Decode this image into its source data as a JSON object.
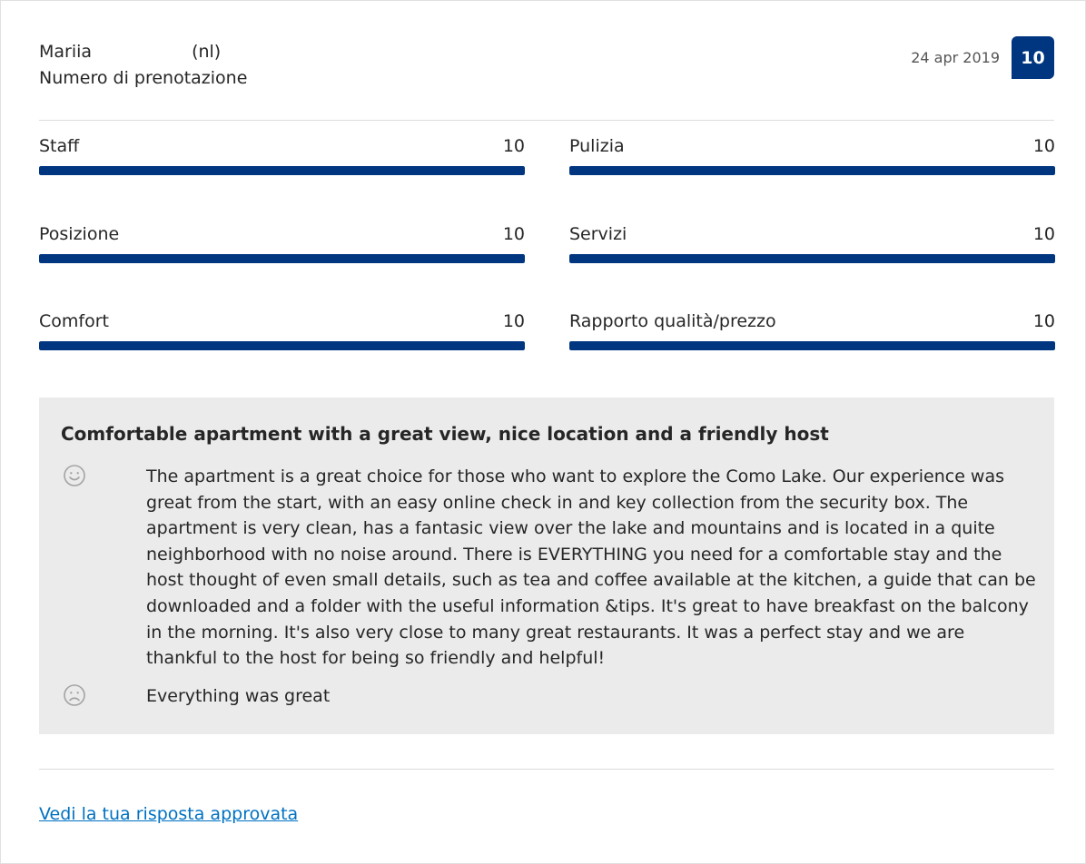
{
  "guest": {
    "name": "Mariia",
    "language": "(nl)",
    "booking_label": "Numero di prenotazione"
  },
  "review_meta": {
    "date": "24 apr 2019",
    "overall_score": "10"
  },
  "category_scores": [
    {
      "label": "Staff",
      "value": "10",
      "fraction": 1.0
    },
    {
      "label": "Pulizia",
      "value": "10",
      "fraction": 1.0
    },
    {
      "label": "Posizione",
      "value": "10",
      "fraction": 1.0
    },
    {
      "label": "Servizi",
      "value": "10",
      "fraction": 1.0
    },
    {
      "label": "Comfort",
      "value": "10",
      "fraction": 1.0
    },
    {
      "label": "Rapporto qualità/prezzo",
      "value": "10",
      "fraction": 1.0
    }
  ],
  "review": {
    "title": "Comfortable apartment with a great view, nice location and a friendly host",
    "positive": "The apartment is a great choice for those who want to explore the Como Lake. Our experience was great from the start, with an easy online check in and key collection from the security box. The apartment is very clean, has a fantasic view over the lake and mountains and is located in a quite neighborhood with no noise around. There is EVERYTHING you need for a comfortable stay and the host thought of even small details, such as tea and coffee available at the kitchen, a guide that can be downloaded and a folder with the useful information &tips. It's great to have breakfast on the balcony in the morning. It's also very close to many great restaurants. It was a perfect stay and we are thankful to the host for being so friendly and helpful!",
    "negative": "Everything was great"
  },
  "footer": {
    "link_label": "Vedi la tua risposta approvata"
  },
  "colors": {
    "brand": "#003580",
    "link": "#0071c2",
    "panel_bg": "#ebebeb"
  },
  "icons": {
    "positive": "smiley-face-icon",
    "negative": "sad-face-icon"
  }
}
